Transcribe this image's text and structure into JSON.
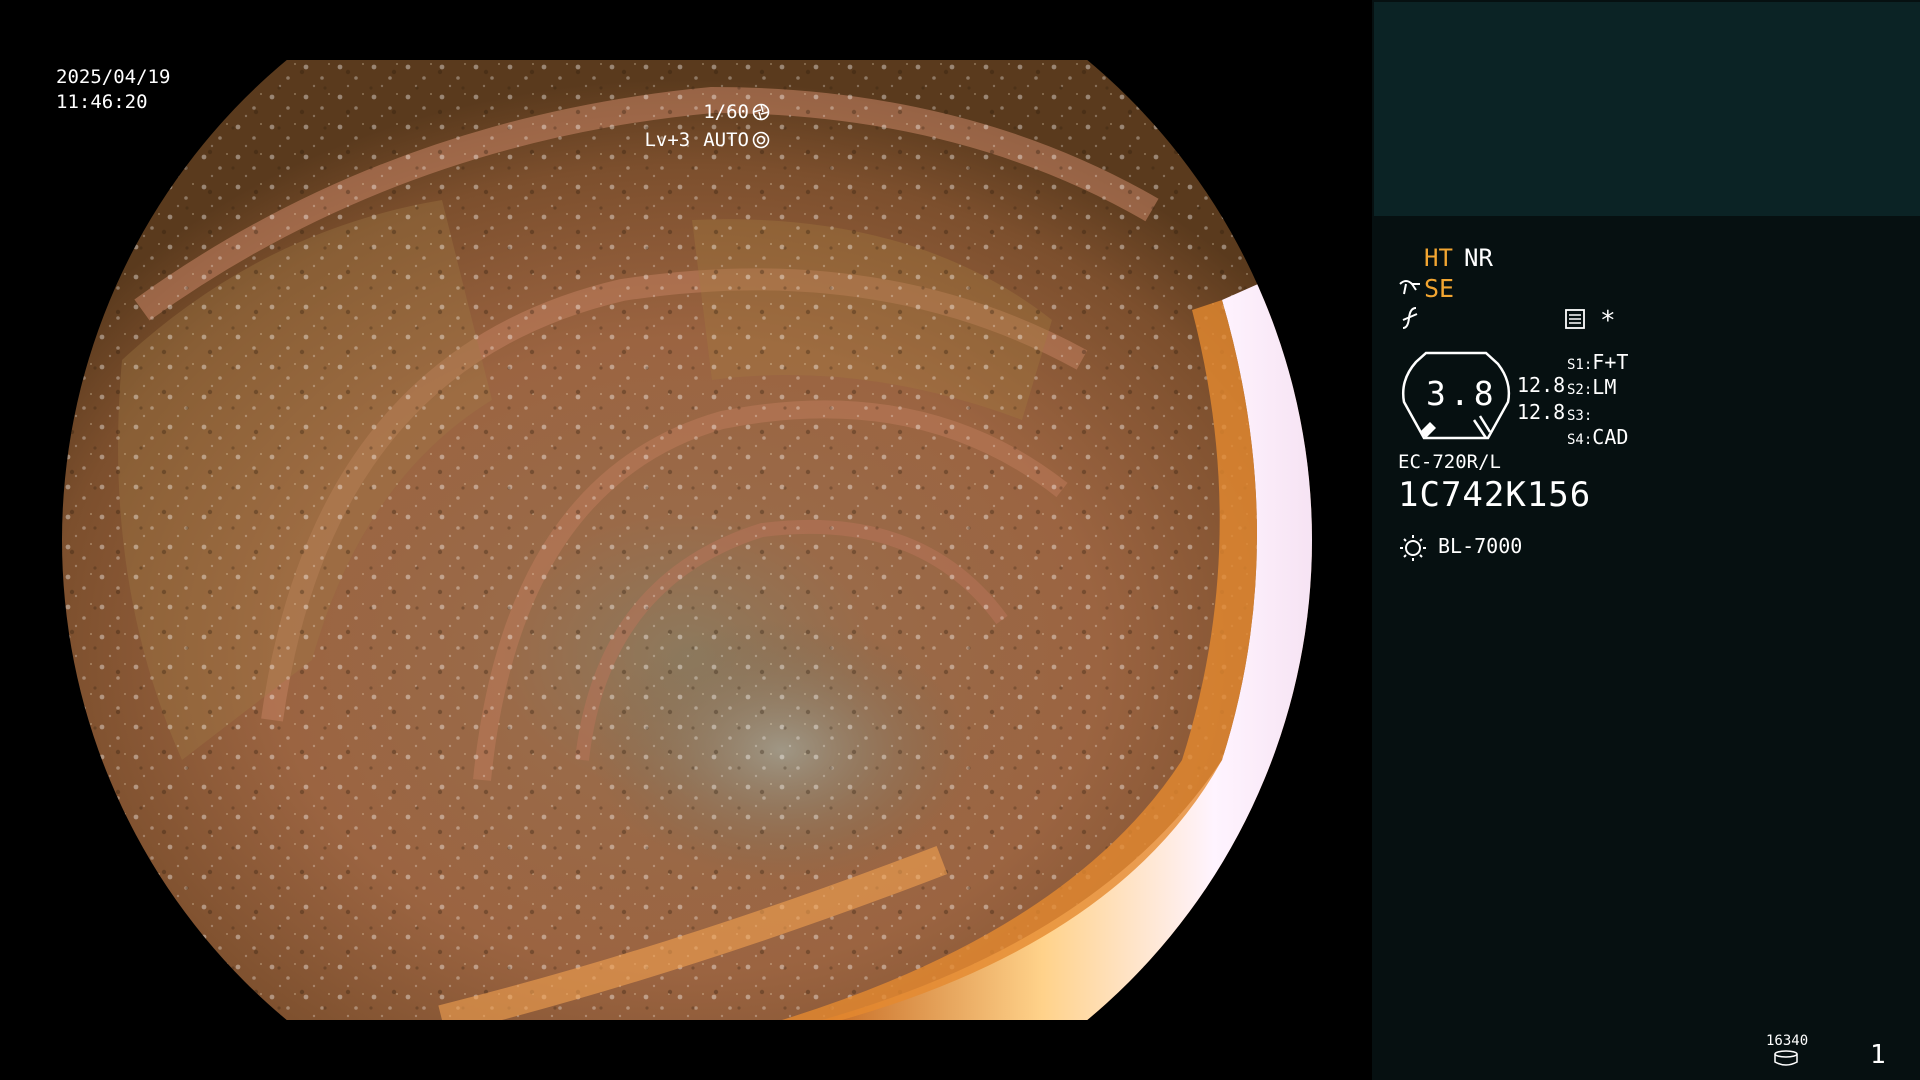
{
  "image_overlay": {
    "date": "2025/04/19",
    "time": "11:46:20",
    "shutter": "1/60",
    "shutter_icon": "aperture-icon",
    "level": "Lv+3",
    "iris_mode": "AUTO",
    "iris_icon": "iris-auto-icon"
  },
  "panel": {
    "mode_ht": "HT",
    "mode_nr": "NR",
    "mode_se": "SE",
    "star": "*",
    "gauge_value": "3.8",
    "gauge_values": [
      "12.8",
      "12.8"
    ],
    "switches": [
      {
        "key": "S1:",
        "value": "F+T"
      },
      {
        "key": "S2:",
        "value": "LM"
      },
      {
        "key": "S3:",
        "value": ""
      },
      {
        "key": "S4:",
        "value": "CAD"
      }
    ],
    "scope_model": "EC-720R/L",
    "scope_serial": "1C742K156",
    "light_source": "BL-7000",
    "disk_count": "16340",
    "page_number": "1"
  },
  "colors": {
    "background": "#000000",
    "panel_bg": "#061011",
    "panel_top_bg": "#0b2325",
    "highlight_orange": "#f2a531",
    "text": "#ffffff"
  }
}
